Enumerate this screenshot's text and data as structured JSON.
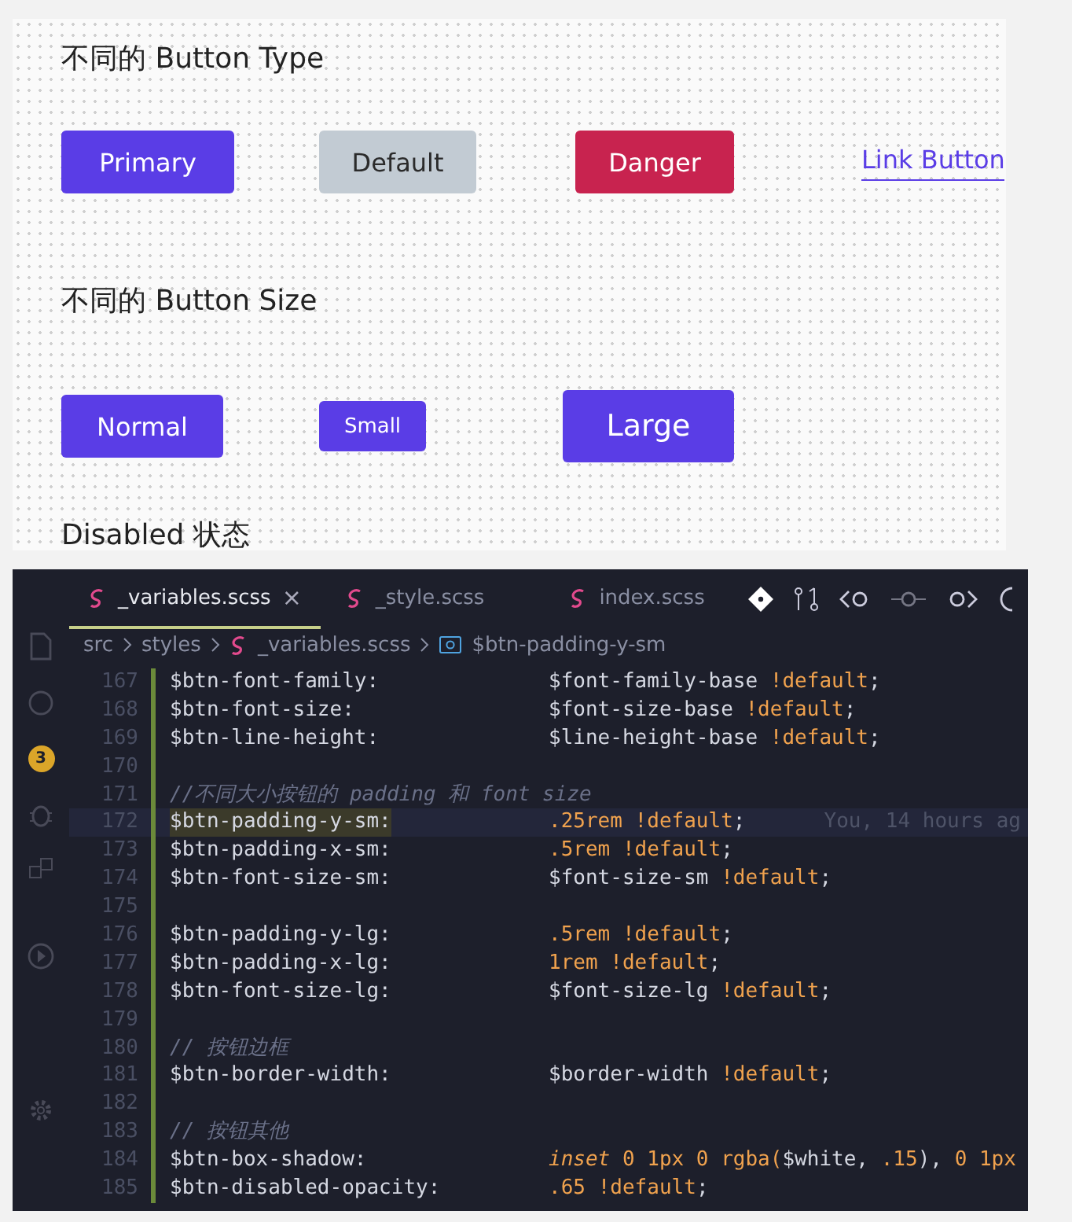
{
  "demo": {
    "sections": [
      {
        "title": "不同的 Button Type",
        "buttons": [
          {
            "label": "Primary",
            "kind": "primary"
          },
          {
            "label": "Default",
            "kind": "default"
          },
          {
            "label": "Danger",
            "kind": "danger"
          },
          {
            "label": "Link Button",
            "kind": "link"
          }
        ]
      },
      {
        "title": "不同的 Button Size",
        "buttons": [
          {
            "label": "Normal",
            "kind": "normal"
          },
          {
            "label": "Small",
            "kind": "small"
          },
          {
            "label": "Large",
            "kind": "large"
          }
        ]
      },
      {
        "title": "Disabled 状态"
      }
    ]
  },
  "editor": {
    "activity_badge": "3",
    "tabs": [
      {
        "label": "_variables.scss",
        "selected": true,
        "close": "×"
      },
      {
        "label": "_style.scss",
        "selected": false
      },
      {
        "label": "index.scss",
        "selected": false
      }
    ],
    "breadcrumb": [
      "src",
      "styles",
      "_variables.scss",
      "$btn-padding-y-sm"
    ],
    "lines": [
      {
        "number": "167",
        "kind": "code",
        "name": "$btn-font-family:",
        "value": [
          {
            "t": "$font-family-base ",
            "kind": "plain"
          },
          {
            "t": "!default",
            "kind": "flag"
          },
          {
            "t": ";",
            "kind": "plain"
          }
        ]
      },
      {
        "number": "168",
        "kind": "code",
        "name": "$btn-font-size:",
        "value": [
          {
            "t": "$font-size-base ",
            "kind": "plain"
          },
          {
            "t": "!default",
            "kind": "flag"
          },
          {
            "t": ";",
            "kind": "plain"
          }
        ]
      },
      {
        "number": "169",
        "kind": "code",
        "name": "$btn-line-height:",
        "value": [
          {
            "t": "$line-height-base ",
            "kind": "plain"
          },
          {
            "t": "!default",
            "kind": "flag"
          },
          {
            "t": ";",
            "kind": "plain"
          }
        ]
      },
      {
        "number": "170",
        "kind": "blank"
      },
      {
        "number": "171",
        "kind": "comment",
        "text": "//不同大小按钮的 padding 和 font size"
      },
      {
        "number": "172",
        "kind": "code",
        "current": true,
        "name": "$btn-padding-y-sm:",
        "value": [
          {
            "t": ".25rem ",
            "kind": "number"
          },
          {
            "t": "!default",
            "kind": "flag"
          },
          {
            "t": ";",
            "kind": "plain"
          }
        ],
        "blame": "You, 14 hours ag"
      },
      {
        "number": "173",
        "kind": "code",
        "name": "$btn-padding-x-sm:",
        "value": [
          {
            "t": ".5rem ",
            "kind": "number"
          },
          {
            "t": "!default",
            "kind": "flag"
          },
          {
            "t": ";",
            "kind": "plain"
          }
        ]
      },
      {
        "number": "174",
        "kind": "code",
        "name": "$btn-font-size-sm:",
        "value": [
          {
            "t": "$font-size-sm ",
            "kind": "plain"
          },
          {
            "t": "!default",
            "kind": "flag"
          },
          {
            "t": ";",
            "kind": "plain"
          }
        ]
      },
      {
        "number": "175",
        "kind": "blank"
      },
      {
        "number": "176",
        "kind": "code",
        "name": "$btn-padding-y-lg:",
        "value": [
          {
            "t": ".5rem ",
            "kind": "number"
          },
          {
            "t": "!default",
            "kind": "flag"
          },
          {
            "t": ";",
            "kind": "plain"
          }
        ]
      },
      {
        "number": "177",
        "kind": "code",
        "name": "$btn-padding-x-lg:",
        "value": [
          {
            "t": "1rem ",
            "kind": "number"
          },
          {
            "t": "!default",
            "kind": "flag"
          },
          {
            "t": ";",
            "kind": "plain"
          }
        ]
      },
      {
        "number": "178",
        "kind": "code",
        "name": "$btn-font-size-lg:",
        "value": [
          {
            "t": "$font-size-lg ",
            "kind": "plain"
          },
          {
            "t": "!default",
            "kind": "flag"
          },
          {
            "t": ";",
            "kind": "plain"
          }
        ]
      },
      {
        "number": "179",
        "kind": "blank"
      },
      {
        "number": "180",
        "kind": "comment",
        "text": "// 按钮边框"
      },
      {
        "number": "181",
        "kind": "code",
        "name": "$btn-border-width:",
        "value": [
          {
            "t": "$border-width ",
            "kind": "plain"
          },
          {
            "t": "!default",
            "kind": "flag"
          },
          {
            "t": ";",
            "kind": "plain"
          }
        ]
      },
      {
        "number": "182",
        "kind": "blank"
      },
      {
        "number": "183",
        "kind": "comment",
        "text": "// 按钮其他"
      },
      {
        "number": "184",
        "kind": "code",
        "name": "$btn-box-shadow:",
        "value": [
          {
            "t": "inset",
            "kind": "italic"
          },
          {
            "t": " 0 1px 0 rgba(",
            "kind": "number"
          },
          {
            "t": "$white, ",
            "kind": "plain"
          },
          {
            "t": ".15",
            "kind": "number"
          },
          {
            "t": "), ",
            "kind": "plain"
          },
          {
            "t": "0 1px",
            "kind": "number"
          }
        ]
      },
      {
        "number": "185",
        "kind": "code",
        "name": "$btn-disabled-opacity:",
        "value": [
          {
            "t": ".65 ",
            "kind": "number"
          },
          {
            "t": "!default",
            "kind": "flag"
          },
          {
            "t": ";",
            "kind": "plain"
          }
        ]
      }
    ]
  }
}
